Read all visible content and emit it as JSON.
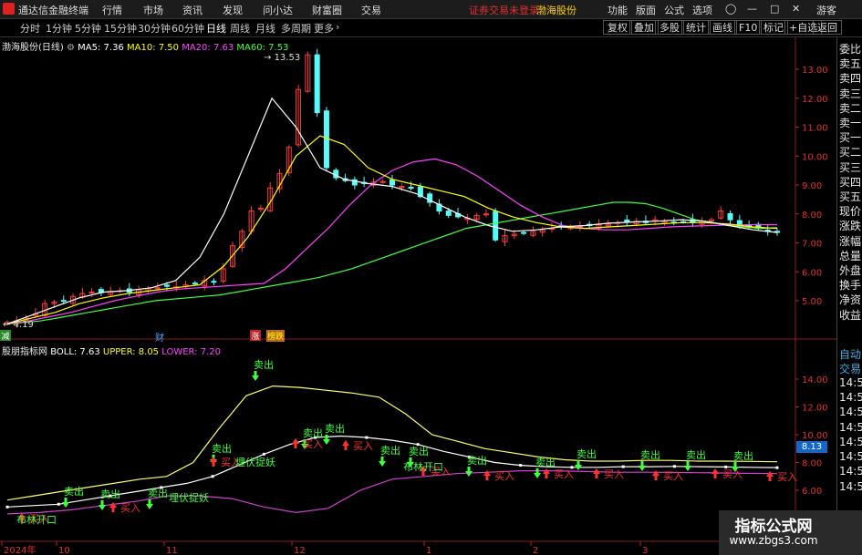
{
  "app": {
    "title": "通达信金融终端",
    "menu": [
      "行情",
      "市场",
      "资讯",
      "发现",
      "问小达",
      "财富圈",
      "交易"
    ],
    "notice": "证券交易未登录",
    "stock_name": "渤海股份",
    "right_menu": [
      "功能",
      "版面",
      "公式",
      "选项"
    ],
    "user": "游客"
  },
  "periods": [
    "分时",
    "1分钟",
    "5分钟",
    "15分钟",
    "30分钟",
    "60分钟",
    "日线",
    "周线",
    "月线",
    "多周期",
    "更多"
  ],
  "active_period": "日线",
  "toolbar_right": [
    "复权",
    "叠加",
    "多股",
    "统计",
    "画线",
    "F10",
    "标记",
    "+自选",
    "返回"
  ],
  "main_chart": {
    "title": "渤海股份(日线)",
    "ma_labels": [
      {
        "text": "MA5: 7.36",
        "color": "#ffffff"
      },
      {
        "text": "MA10: 7.50",
        "color": "#ffff00"
      },
      {
        "text": "MA20: 7.63",
        "color": "#ff40ff"
      },
      {
        "text": "MA60: 7.53",
        "color": "#40ff40"
      }
    ],
    "high_label": "13.53",
    "low_label": "4.19",
    "event_marks": [
      "减",
      "财",
      "涨",
      "榜跌"
    ]
  },
  "sub_chart": {
    "title": "股朋指标网",
    "boll_labels": [
      {
        "text": "BOLL: 7.63",
        "color": "#ffffff"
      },
      {
        "text": "UPPER: 8.05",
        "color": "#ffff00"
      },
      {
        "text": "LOWER: 7.20",
        "color": "#ff40ff"
      }
    ],
    "current_value": "8.13",
    "signals": {
      "sell": "卖出",
      "buy": "买入",
      "boll_open": "布林开口",
      "ambush": "埋伏捉妖"
    }
  },
  "right_panel": [
    "委比",
    "卖五",
    "卖四",
    "卖三",
    "卖二",
    "卖一",
    "买一",
    "买二",
    "买三",
    "买四",
    "买五",
    "现价",
    "涨跌",
    "涨幅",
    "总量",
    "外盘",
    "换手",
    "净资",
    "收益"
  ],
  "right_panel_bottom": [
    "自动",
    "交易",
    "14:5",
    "14:5",
    "14:5",
    "14:5",
    "14:5",
    "14:5",
    "14:5",
    "14:5"
  ],
  "watermark": {
    "title": "指标公式网",
    "url": "www.zbgs3.com"
  },
  "chart_data": [
    {
      "type": "candlestick",
      "title": "渤海股份(日线)",
      "y_ticks": [
        5.0,
        6.0,
        7.0,
        8.0,
        9.0,
        10.0,
        11.0,
        12.0,
        13.0
      ],
      "ylim": [
        4.0,
        13.9
      ],
      "x_labels": [
        "2024年",
        "10",
        "11",
        "12",
        "1",
        "2",
        "3"
      ],
      "close": [
        4.25,
        4.3,
        4.4,
        4.55,
        4.9,
        4.95,
        5.0,
        5.15,
        5.25,
        5.3,
        5.28,
        5.32,
        5.35,
        5.3,
        5.38,
        5.42,
        5.45,
        5.5,
        5.48,
        5.55,
        5.6,
        5.7,
        5.65,
        6.1,
        6.9,
        7.4,
        8.1,
        8.2,
        8.9,
        9.4,
        10.3,
        12.3,
        13.5,
        11.5,
        9.6,
        9.25,
        9.15,
        9.0,
        9.05,
        9.1,
        9.12,
        9.0,
        8.95,
        8.9,
        8.6,
        8.4,
        8.1,
        7.95,
        7.9,
        7.85,
        7.95,
        8.0,
        7.1,
        7.25,
        7.3,
        7.35,
        7.4,
        7.45,
        7.5,
        7.55,
        7.55,
        7.58,
        7.6,
        7.62,
        7.65,
        7.7,
        7.72,
        7.75,
        7.7,
        7.8,
        7.75,
        7.7,
        7.72,
        7.7,
        7.75,
        7.8,
        8.1,
        7.8,
        7.6,
        7.55,
        7.5,
        7.4,
        7.36
      ],
      "ma5_last": 7.36,
      "ma10_last": 7.5,
      "ma20_last": 7.63,
      "ma60_last": 7.53,
      "ma60": [
        4.2,
        4.25,
        4.3,
        4.4,
        4.5,
        4.6,
        4.7,
        4.8,
        4.9,
        5.0,
        5.05,
        5.1,
        5.15,
        5.2,
        5.3,
        5.4,
        5.5,
        5.6,
        5.7,
        5.8,
        5.95,
        6.1,
        6.3,
        6.5,
        6.7,
        6.9,
        7.1,
        7.3,
        7.5,
        7.6,
        7.7,
        7.8,
        7.9,
        8.0,
        8.1,
        8.2,
        8.3,
        8.4,
        8.4,
        8.35,
        8.2,
        8.0,
        7.8,
        7.7,
        7.6,
        7.55,
        7.5,
        7.53
      ],
      "ma20": [
        4.2,
        4.3,
        4.45,
        4.6,
        4.8,
        5.0,
        5.15,
        5.3,
        5.4,
        5.45,
        5.5,
        5.55,
        5.6,
        6.1,
        6.8,
        7.5,
        8.3,
        9.0,
        9.5,
        9.8,
        9.9,
        9.7,
        9.3,
        8.8,
        8.3,
        7.9,
        7.6,
        7.5,
        7.45,
        7.45,
        7.5,
        7.55,
        7.58,
        7.6,
        7.62,
        7.63,
        7.63
      ],
      "ma10": [
        4.2,
        4.4,
        4.6,
        4.9,
        5.1,
        5.25,
        5.35,
        5.45,
        5.55,
        6.2,
        7.2,
        8.5,
        10.0,
        10.7,
        10.4,
        9.6,
        9.2,
        9.0,
        8.8,
        8.6,
        8.2,
        7.9,
        7.7,
        7.55,
        7.5,
        7.55,
        7.6,
        7.65,
        7.7,
        7.7,
        7.65,
        7.55,
        7.5
      ],
      "ma5": [
        4.2,
        4.5,
        4.8,
        5.1,
        5.3,
        5.35,
        5.45,
        5.7,
        6.5,
        8.0,
        10.0,
        12.0,
        11.0,
        9.6,
        9.2,
        9.05,
        8.95,
        8.7,
        8.3,
        7.9,
        7.6,
        7.4,
        7.45,
        7.55,
        7.6,
        7.68,
        7.72,
        7.75,
        7.8,
        7.75,
        7.6,
        7.45,
        7.36
      ]
    },
    {
      "type": "line",
      "title": "股朋指标网",
      "y_ticks": [
        6.0,
        8.0,
        10.0,
        12.0,
        14.0
      ],
      "ylim": [
        5.0,
        14.5
      ],
      "series": [
        {
          "name": "BOLL",
          "last": 7.63,
          "values": [
            4.8,
            4.9,
            5.0,
            5.3,
            5.6,
            5.9,
            6.2,
            6.5,
            7.0,
            7.8,
            8.6,
            9.3,
            9.8,
            9.9,
            9.8,
            9.6,
            9.3,
            8.8,
            8.4,
            8.0,
            7.8,
            7.7,
            7.65,
            7.65,
            7.7,
            7.7,
            7.72,
            7.7,
            7.68,
            7.65,
            7.63
          ]
        },
        {
          "name": "UPPER",
          "last": 8.05,
          "values": [
            5.3,
            5.6,
            5.9,
            6.2,
            6.5,
            6.8,
            7.0,
            8.0,
            10.5,
            12.8,
            13.5,
            13.4,
            13.2,
            13.0,
            12.7,
            11.5,
            10.0,
            9.5,
            9.0,
            8.7,
            8.4,
            8.2,
            8.1,
            8.1,
            8.15,
            8.15,
            8.1,
            8.1,
            8.08,
            8.05
          ]
        },
        {
          "name": "LOWER",
          "last": 7.2,
          "values": [
            4.3,
            4.4,
            4.6,
            4.9,
            5.2,
            5.6,
            5.6,
            5.4,
            4.8,
            4.4,
            4.7,
            6.0,
            6.8,
            7.0,
            7.2,
            7.3,
            7.4,
            7.4,
            7.35,
            7.3,
            7.3,
            7.28,
            7.25,
            7.22,
            7.2
          ]
        }
      ]
    }
  ]
}
